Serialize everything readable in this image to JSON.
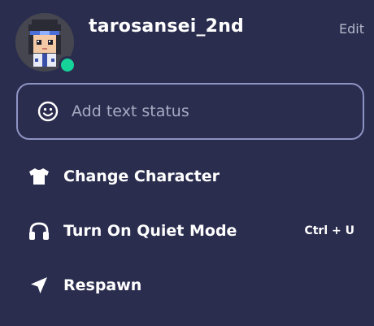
{
  "profile": {
    "username": "tarosansei_2nd",
    "edit_label": "Edit",
    "status_color": "#16d39a",
    "avatar_icon": "pixel-character-avatar"
  },
  "status_input": {
    "placeholder": "Add text status",
    "icon": "smile-icon"
  },
  "menu": {
    "items": [
      {
        "label": "Change Character",
        "icon": "tshirt-icon",
        "shortcut": ""
      },
      {
        "label": "Turn On Quiet Mode",
        "icon": "headphones-icon",
        "shortcut": "Ctrl + U"
      },
      {
        "label": "Respawn",
        "icon": "location-arrow-icon",
        "shortcut": ""
      }
    ]
  },
  "colors": {
    "panel_bg": "#2a2d4e",
    "input_border": "#8e93c4",
    "muted_text": "#a8abc2"
  }
}
